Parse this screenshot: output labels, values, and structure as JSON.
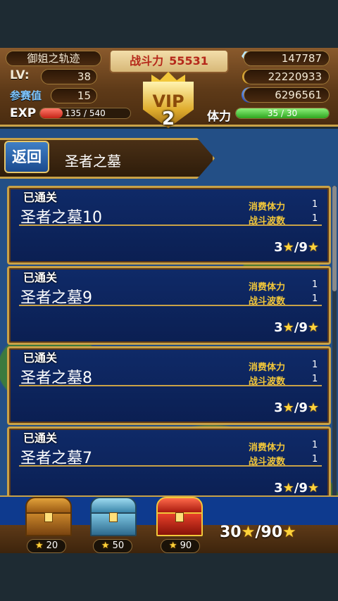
{
  "header": {
    "player_name": "御姐之轨迹",
    "lv_label": "LV:",
    "lv_value": "38",
    "rank_label": "参赛值",
    "rank_value": "15",
    "power_label": "战斗力",
    "power_value": "55531",
    "vip_label": "VIP",
    "vip_level": "2",
    "gems": "147787",
    "gold": "22220933",
    "orbs": "6296561",
    "exp_label": "EXP",
    "exp_text": "135 / 540",
    "exp_progress": 0.25,
    "stamina_label": "体力",
    "stamina_text": "35 / 30",
    "stamina_progress": 1.0
  },
  "nav": {
    "back_label": "返回",
    "title": "圣者之墓"
  },
  "stages": [
    {
      "status": "已通关",
      "name": "圣者之墓10",
      "cost_label": "消费体力",
      "cost_value": "1",
      "waves_label": "战斗波数",
      "waves_value": "1",
      "stars": "3",
      "max_stars": "/9"
    },
    {
      "status": "已通关",
      "name": "圣者之墓9",
      "cost_label": "消费体力",
      "cost_value": "1",
      "waves_label": "战斗波数",
      "waves_value": "1",
      "stars": "3",
      "max_stars": "/9"
    },
    {
      "status": "已通关",
      "name": "圣者之墓8",
      "cost_label": "消费体力",
      "cost_value": "1",
      "waves_label": "战斗波数",
      "waves_value": "1",
      "stars": "3",
      "max_stars": "/9"
    },
    {
      "status": "已通关",
      "name": "圣者之墓7",
      "cost_label": "消费体力",
      "cost_value": "1",
      "waves_label": "战斗波数",
      "waves_value": "1",
      "stars": "3",
      "max_stars": "/9"
    }
  ],
  "rewards": {
    "chests": [
      {
        "name": "wooden-chest",
        "required": "20"
      },
      {
        "name": "silver-chest",
        "required": "50"
      },
      {
        "name": "red-chest",
        "required": "90"
      }
    ],
    "collected": "30",
    "total": "/90"
  },
  "colors": {
    "wood": "#5e3a18",
    "gold_trim": "#c9a247",
    "panel_blue": "#0f2a68",
    "accent_yellow": "#f2c73a",
    "exp_red": "#c42316",
    "stamina_green": "#2ea61e"
  }
}
